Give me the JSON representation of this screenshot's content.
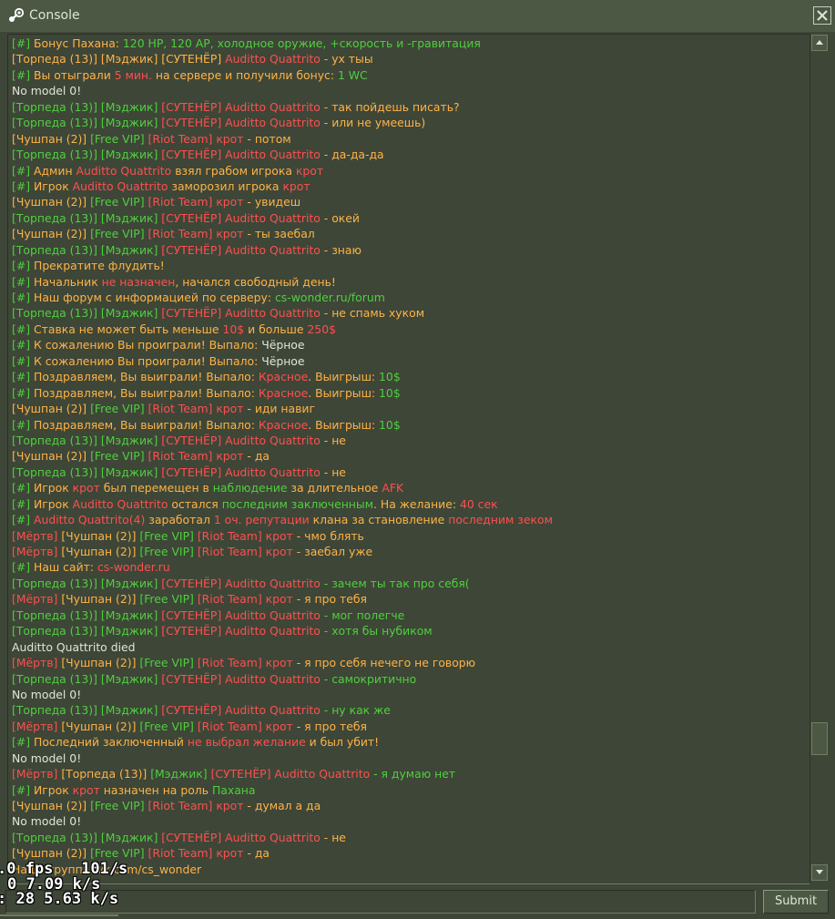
{
  "window": {
    "title": "Console"
  },
  "colors": {
    "default": "#dfe6d7",
    "green": "#4fcf3f",
    "orange": "#ffb347",
    "red": "#ff4f4f"
  },
  "log_lines": [
    [
      [
        "g",
        "[#] "
      ],
      [
        "o",
        "Бонус Пахана: "
      ],
      [
        "g",
        "120 HP, 120 AP, холодное оружие, +скорость и -гравитация"
      ]
    ],
    [
      [
        "o",
        "[Торпеда (13)] "
      ],
      [
        "o",
        "[Мэджик] "
      ],
      [
        "o",
        "[СУТЕНЁР] "
      ],
      [
        "r",
        "Auditto Quattrito"
      ],
      [
        "o",
        " - ух тыы"
      ]
    ],
    [
      [
        "g",
        "[#] "
      ],
      [
        "o",
        "Вы отыграли "
      ],
      [
        "r",
        "5 мин."
      ],
      [
        "o",
        " на сервере и получили бонус: "
      ],
      [
        "g",
        "1 WC"
      ]
    ],
    [
      [
        "w",
        "No model 0!"
      ]
    ],
    [
      [
        "g",
        "[Торпеда (13)] "
      ],
      [
        "g",
        "[Мэджик] "
      ],
      [
        "r",
        "[СУТЕНЁР] "
      ],
      [
        "r",
        "Auditto Quattrito"
      ],
      [
        "o",
        " - так пойдешь писать?"
      ]
    ],
    [
      [
        "g",
        "[Торпеда (13)] "
      ],
      [
        "g",
        "[Мэджик] "
      ],
      [
        "r",
        "[СУТЕНЁР] "
      ],
      [
        "r",
        "Auditto Quattrito"
      ],
      [
        "o",
        " - или не умеешь)"
      ]
    ],
    [
      [
        "o",
        "[Чушпан (2)] "
      ],
      [
        "g",
        "[Free VIP] "
      ],
      [
        "r",
        "[Riot Team] "
      ],
      [
        "r",
        "крот"
      ],
      [
        "o",
        " - потом"
      ]
    ],
    [
      [
        "g",
        "[Торпеда (13)] "
      ],
      [
        "g",
        "[Мэджик] "
      ],
      [
        "r",
        "[СУТЕНЁР] "
      ],
      [
        "r",
        "Auditto Quattrito"
      ],
      [
        "o",
        " - да-да-да"
      ]
    ],
    [
      [
        "g",
        "[#] "
      ],
      [
        "o",
        "Админ "
      ],
      [
        "r",
        "Auditto Quattrito"
      ],
      [
        "o",
        " взял грабом игрока "
      ],
      [
        "r",
        "крот"
      ]
    ],
    [
      [
        "g",
        "[#] "
      ],
      [
        "o",
        "Игрок "
      ],
      [
        "r",
        "Auditto Quattrito"
      ],
      [
        "o",
        " заморозил игрока "
      ],
      [
        "r",
        "крот"
      ]
    ],
    [
      [
        "o",
        "[Чушпан (2)] "
      ],
      [
        "g",
        "[Free VIP] "
      ],
      [
        "r",
        "[Riot Team] "
      ],
      [
        "r",
        "крот"
      ],
      [
        "o",
        " - увидеш"
      ]
    ],
    [
      [
        "g",
        "[Торпеда (13)] "
      ],
      [
        "g",
        "[Мэджик] "
      ],
      [
        "r",
        "[СУТЕНЁР] "
      ],
      [
        "r",
        "Auditto Quattrito"
      ],
      [
        "o",
        " - окей"
      ]
    ],
    [
      [
        "o",
        "[Чушпан (2)] "
      ],
      [
        "g",
        "[Free VIP] "
      ],
      [
        "r",
        "[Riot Team] "
      ],
      [
        "r",
        "крот"
      ],
      [
        "o",
        " - ты заебал"
      ]
    ],
    [
      [
        "g",
        "[Торпеда (13)] "
      ],
      [
        "g",
        "[Мэджик] "
      ],
      [
        "r",
        "[СУТЕНЁР] "
      ],
      [
        "r",
        "Auditto Quattrito"
      ],
      [
        "o",
        " - знаю"
      ]
    ],
    [
      [
        "g",
        "[#] "
      ],
      [
        "o",
        "Прекратите флудить!"
      ]
    ],
    [
      [
        "g",
        "[#] "
      ],
      [
        "o",
        "Начальник "
      ],
      [
        "r",
        "не назначен"
      ],
      [
        "o",
        ", начался свободный день!"
      ]
    ],
    [
      [
        "g",
        "[#] "
      ],
      [
        "o",
        "Наш форум с информацией по серверу: "
      ],
      [
        "g",
        "cs-wonder.ru/forum"
      ]
    ],
    [
      [
        "g",
        "[Торпеда (13)] "
      ],
      [
        "g",
        "[Мэджик] "
      ],
      [
        "r",
        "[СУТЕНЁР] "
      ],
      [
        "r",
        "Auditto Quattrito"
      ],
      [
        "o",
        " - не спамь хуком"
      ]
    ],
    [
      [
        "g",
        "[#] "
      ],
      [
        "o",
        "Ставка не может быть меньше "
      ],
      [
        "r",
        "10$"
      ],
      [
        "o",
        " и больше "
      ],
      [
        "r",
        "250$"
      ]
    ],
    [
      [
        "g",
        "[#] "
      ],
      [
        "o",
        "К сожалению Вы проиграли! Выпало: "
      ],
      [
        "w",
        "Чёрное"
      ]
    ],
    [
      [
        "g",
        "[#] "
      ],
      [
        "o",
        "К сожалению Вы проиграли! Выпало: "
      ],
      [
        "w",
        "Чёрное"
      ]
    ],
    [
      [
        "g",
        "[#] "
      ],
      [
        "o",
        "Поздравляем, Вы выиграли! Выпало: "
      ],
      [
        "r",
        "Красное"
      ],
      [
        "o",
        ". Выигрыш: "
      ],
      [
        "g",
        "10$"
      ]
    ],
    [
      [
        "g",
        "[#] "
      ],
      [
        "o",
        "Поздравляем, Вы выиграли! Выпало: "
      ],
      [
        "r",
        "Красное"
      ],
      [
        "o",
        ". Выигрыш: "
      ],
      [
        "g",
        "10$"
      ]
    ],
    [
      [
        "o",
        "[Чушпан (2)] "
      ],
      [
        "g",
        "[Free VIP] "
      ],
      [
        "r",
        "[Riot Team] "
      ],
      [
        "r",
        "крот"
      ],
      [
        "o",
        " - иди навиг"
      ]
    ],
    [
      [
        "g",
        "[#] "
      ],
      [
        "o",
        "Поздравляем, Вы выиграли! Выпало: "
      ],
      [
        "r",
        "Красное"
      ],
      [
        "o",
        ". Выигрыш: "
      ],
      [
        "g",
        "10$"
      ]
    ],
    [
      [
        "g",
        "[Торпеда (13)] "
      ],
      [
        "g",
        "[Мэджик] "
      ],
      [
        "r",
        "[СУТЕНЁР] "
      ],
      [
        "r",
        "Auditto Quattrito"
      ],
      [
        "o",
        " - не"
      ]
    ],
    [
      [
        "o",
        "[Чушпан (2)] "
      ],
      [
        "g",
        "[Free VIP] "
      ],
      [
        "r",
        "[Riot Team] "
      ],
      [
        "r",
        "крот"
      ],
      [
        "o",
        " - да"
      ]
    ],
    [
      [
        "g",
        "[Торпеда (13)] "
      ],
      [
        "g",
        "[Мэджик] "
      ],
      [
        "r",
        "[СУТЕНЁР] "
      ],
      [
        "r",
        "Auditto Quattrito"
      ],
      [
        "o",
        " - не"
      ]
    ],
    [
      [
        "g",
        "[#] "
      ],
      [
        "o",
        "Игрок "
      ],
      [
        "r",
        "крот"
      ],
      [
        "o",
        " был перемещен в "
      ],
      [
        "g",
        "наблюдение"
      ],
      [
        "o",
        " за длительное "
      ],
      [
        "r",
        "AFK"
      ]
    ],
    [
      [
        "g",
        "[#] "
      ],
      [
        "o",
        "Игрок "
      ],
      [
        "r",
        "Auditto Quattrito"
      ],
      [
        "o",
        " остался "
      ],
      [
        "g",
        "последним заключенным"
      ],
      [
        "o",
        ". На желание: "
      ],
      [
        "r",
        "40 сек"
      ]
    ],
    [
      [
        "g",
        "[#] "
      ],
      [
        "r",
        "Auditto Quattrito(4)"
      ],
      [
        "o",
        " заработал "
      ],
      [
        "r",
        "1 оч. репутации"
      ],
      [
        "o",
        " клана за становление "
      ],
      [
        "r",
        "последним зеком"
      ]
    ],
    [
      [
        "r",
        "[Мёртв] "
      ],
      [
        "o",
        "[Чушпан (2)] "
      ],
      [
        "g",
        "[Free VIP] "
      ],
      [
        "r",
        "[Riot Team] "
      ],
      [
        "r",
        "крот"
      ],
      [
        "o",
        " - чмо блять"
      ]
    ],
    [
      [
        "r",
        "[Мёртв] "
      ],
      [
        "o",
        "[Чушпан (2)] "
      ],
      [
        "g",
        "[Free VIP] "
      ],
      [
        "r",
        "[Riot Team] "
      ],
      [
        "r",
        "крот"
      ],
      [
        "o",
        " - заебал уже"
      ]
    ],
    [
      [
        "g",
        "[#] "
      ],
      [
        "o",
        "Наш сайт: "
      ],
      [
        "r",
        "cs-wonder.ru"
      ]
    ],
    [
      [
        "g",
        "[Торпеда (13)] "
      ],
      [
        "g",
        "[Мэджик] "
      ],
      [
        "r",
        "[СУТЕНЁР] "
      ],
      [
        "r",
        "Auditto Quattrito"
      ],
      [
        "g",
        " - зачем ты так про себя("
      ]
    ],
    [
      [
        "r",
        "[Мёртв] "
      ],
      [
        "o",
        "[Чушпан (2)] "
      ],
      [
        "g",
        "[Free VIP] "
      ],
      [
        "r",
        "[Riot Team] "
      ],
      [
        "r",
        "крот"
      ],
      [
        "o",
        " - я про тебя"
      ]
    ],
    [
      [
        "g",
        "[Торпеда (13)] "
      ],
      [
        "g",
        "[Мэджик] "
      ],
      [
        "r",
        "[СУТЕНЁР] "
      ],
      [
        "r",
        "Auditto Quattrito"
      ],
      [
        "g",
        " - мог полегче"
      ]
    ],
    [
      [
        "g",
        "[Торпеда (13)] "
      ],
      [
        "g",
        "[Мэджик] "
      ],
      [
        "r",
        "[СУТЕНЁР] "
      ],
      [
        "r",
        "Auditto Quattrito"
      ],
      [
        "g",
        " - хотя бы нубиком"
      ]
    ],
    [
      [
        "w",
        "Auditto Quattrito died"
      ]
    ],
    [
      [
        "r",
        "[Мёртв] "
      ],
      [
        "o",
        "[Чушпан (2)] "
      ],
      [
        "g",
        "[Free VIP] "
      ],
      [
        "r",
        "[Riot Team] "
      ],
      [
        "r",
        "крот"
      ],
      [
        "o",
        " - я про себя нечего не говорю"
      ]
    ],
    [
      [
        "g",
        "[Торпеда (13)] "
      ],
      [
        "g",
        "[Мэджик] "
      ],
      [
        "r",
        "[СУТЕНЁР] "
      ],
      [
        "r",
        "Auditto Quattrito"
      ],
      [
        "g",
        " - самокритично"
      ]
    ],
    [
      [
        "w",
        "No model 0!"
      ]
    ],
    [
      [
        "g",
        "[Торпеда (13)] "
      ],
      [
        "g",
        "[Мэджик] "
      ],
      [
        "r",
        "[СУТЕНЁР] "
      ],
      [
        "r",
        "Auditto Quattrito"
      ],
      [
        "g",
        " - ну как же"
      ]
    ],
    [
      [
        "r",
        "[Мёртв] "
      ],
      [
        "o",
        "[Чушпан (2)] "
      ],
      [
        "g",
        "[Free VIP] "
      ],
      [
        "r",
        "[Riot Team] "
      ],
      [
        "r",
        "крот"
      ],
      [
        "o",
        " - я про тебя"
      ]
    ],
    [
      [
        "g",
        "[#] "
      ],
      [
        "o",
        "Последний заключенный "
      ],
      [
        "r",
        "не выбрал желание"
      ],
      [
        "o",
        " и был убит!"
      ]
    ],
    [
      [
        "w",
        "No model 0!"
      ]
    ],
    [
      [
        "r",
        "[Мёртв] "
      ],
      [
        "o",
        "[Торпеда (13)] "
      ],
      [
        "g",
        "[Мэджик] "
      ],
      [
        "r",
        "[СУТЕНЁР] "
      ],
      [
        "r",
        "Auditto Quattrito"
      ],
      [
        "g",
        " - я думаю нет"
      ]
    ],
    [
      [
        "g",
        "[#] "
      ],
      [
        "o",
        "Игрок "
      ],
      [
        "r",
        "крот"
      ],
      [
        "o",
        " назначен на роль "
      ],
      [
        "g",
        "Пахана"
      ]
    ],
    [
      [
        "o",
        "[Чушпан (2)] "
      ],
      [
        "g",
        "[Free VIP] "
      ],
      [
        "r",
        "[Riot Team] "
      ],
      [
        "r",
        "крот"
      ],
      [
        "o",
        " - думал а да"
      ]
    ],
    [
      [
        "w",
        "No model 0!"
      ]
    ],
    [
      [
        "g",
        "[Торпеда (13)] "
      ],
      [
        "g",
        "[Мэджик] "
      ],
      [
        "r",
        "[СУТЕНЁР] "
      ],
      [
        "r",
        "Auditto Quattrito"
      ],
      [
        "o",
        " - не"
      ]
    ],
    [
      [
        "o",
        "[Чушпан (2)] "
      ],
      [
        "g",
        "[Free VIP] "
      ],
      [
        "r",
        "[Riot Team] "
      ],
      [
        "r",
        "крот"
      ],
      [
        "o",
        " - да"
      ]
    ],
    [
      [
        "o",
        "Наша группа: vk.com/cs_wonder"
      ]
    ]
  ],
  "input": {
    "value": "",
    "placeholder": ""
  },
  "submit_label": "Submit",
  "netgraph": {
    "line1": ".0 fps   101/s",
    "line2": "0 7.09 k/s",
    "line3": ": 28 5.63 k/s"
  }
}
